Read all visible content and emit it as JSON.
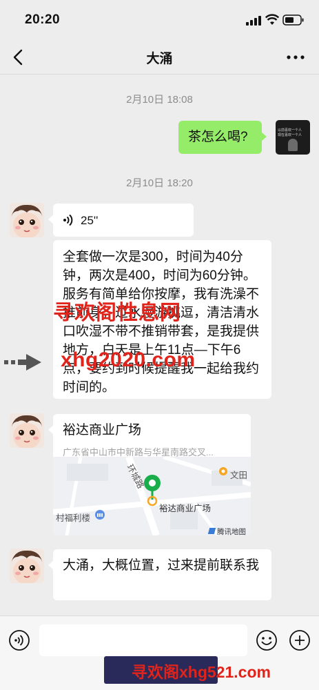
{
  "status": {
    "time": "20:20"
  },
  "nav": {
    "title": "大涌"
  },
  "messages": {
    "ts1": "2月10日 18:08",
    "sent1": "茶怎么喝?",
    "sent1_avatar_line1": "以前喜欢一个人",
    "sent1_avatar_line2": "现在喜欢一个人",
    "ts2": "2月10日 18:20",
    "voice_duration": "25''",
    "text1": "全套做一次是300，时间为40分钟，两次是400，时间为60分钟。服务有简单给你按摩，我有洗澡不推前身，过水漫游挑逗，清洁清水口吹湿不带不推销带套，是我提供地方，白天是上午11点—下午6点，要约到时候提醒我一起给我约时间的。",
    "location_name": "裕达商业广场",
    "location_address": "广东省中山市中新路与华星南路交叉...",
    "map_labels": {
      "poi_wentian": "文田",
      "poi_building": "村福利楼",
      "road": "环城路",
      "marker": "裕达商业广场",
      "provider": "腾讯地图"
    },
    "text2": "大涌，大概位置，过来提前联系我"
  },
  "watermarks": {
    "top_cn": "寻欢阁性息网",
    "top_url": "xhg2020.com",
    "bottom": "寻欢阁xhg521.com"
  },
  "colors": {
    "sent_bubble": "#95ec69",
    "received_bubble": "#ffffff",
    "background": "#ededed",
    "watermark_red": "#e0231b",
    "marker_green": "#1aad4b",
    "watermark_bg": "#2a2a5a"
  }
}
